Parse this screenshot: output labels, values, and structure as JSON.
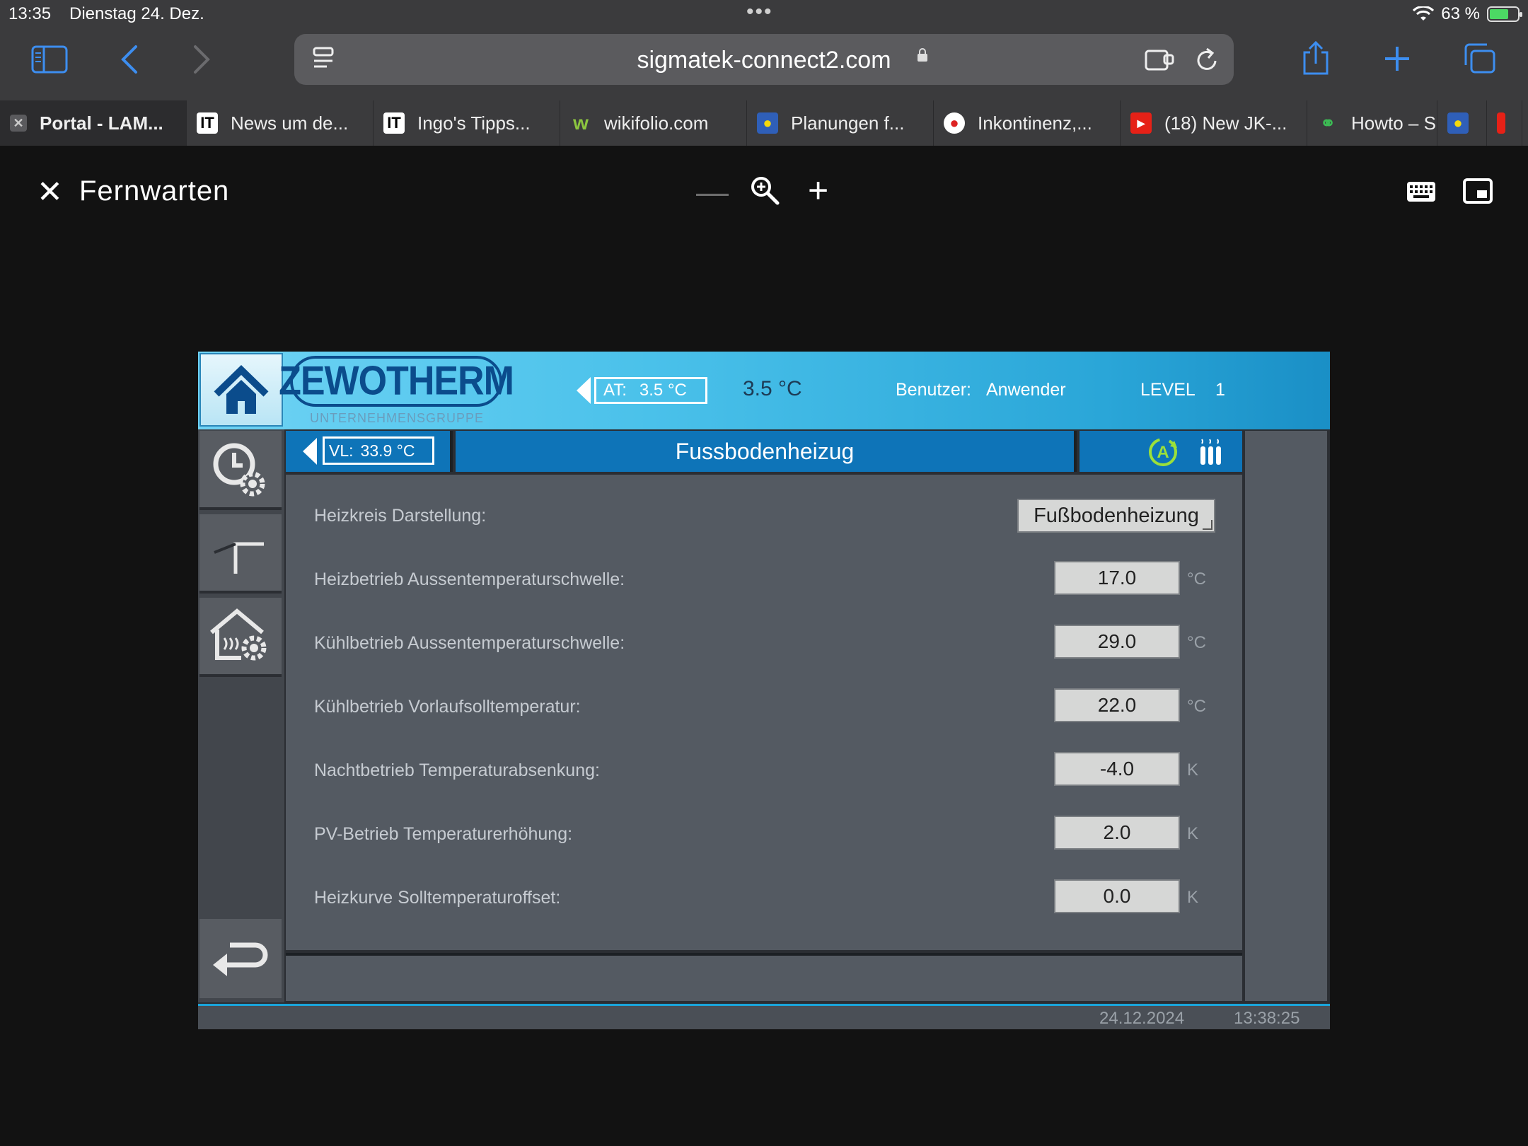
{
  "status_bar": {
    "time": "13:35",
    "date": "Dienstag 24. Dez.",
    "battery": "63 %"
  },
  "browser": {
    "url": "sigmatek-connect2.com",
    "tabs": [
      {
        "label": "Portal - LAM...",
        "active": true
      },
      {
        "label": "News um de..."
      },
      {
        "label": "Ingo's Tipps..."
      },
      {
        "label": "wikifolio.com"
      },
      {
        "label": "Planungen f..."
      },
      {
        "label": "Inkontinenz,..."
      },
      {
        "label": "(18) New JK-..."
      },
      {
        "label": "Howto – S"
      }
    ]
  },
  "remote": {
    "title": "Fernwarten"
  },
  "hmi": {
    "logo": "ZEWOTHERM",
    "logo_sub": "UNTERNEHMENSGRUPPE",
    "at_label": "AT:",
    "at_value": "3.5 °C",
    "at_value2": "3.5 °C",
    "user_label": "Benutzer:",
    "user_name": "Anwender",
    "level_label": "LEVEL",
    "level_value": "1",
    "vl_label": "VL:",
    "vl_value": "33.9 °C",
    "page_title": "Fussbodenheizug",
    "mode_letter": "A",
    "heizkreis_label": "Heizkreis Darstellung:",
    "heizkreis_value": "Fußbodenheizung",
    "rows": [
      {
        "label": "Heizbetrieb Aussentemperaturschwelle:",
        "value": "17.0",
        "unit": "°C"
      },
      {
        "label": "Kühlbetrieb Aussentemperaturschwelle:",
        "value": "29.0",
        "unit": "°C"
      },
      {
        "label": "Kühlbetrieb Vorlaufsolltemperatur:",
        "value": "22.0",
        "unit": "°C"
      },
      {
        "label": "Nachtbetrieb Temperaturabsenkung:",
        "value": "-4.0",
        "unit": "K"
      },
      {
        "label": "PV-Betrieb Temperaturerhöhung:",
        "value": "2.0",
        "unit": "K"
      },
      {
        "label": "Heizkurve Solltemperaturoffset:",
        "value": "0.0",
        "unit": "K"
      }
    ],
    "footer_date": "24.12.2024",
    "footer_time": "13:38:25"
  }
}
